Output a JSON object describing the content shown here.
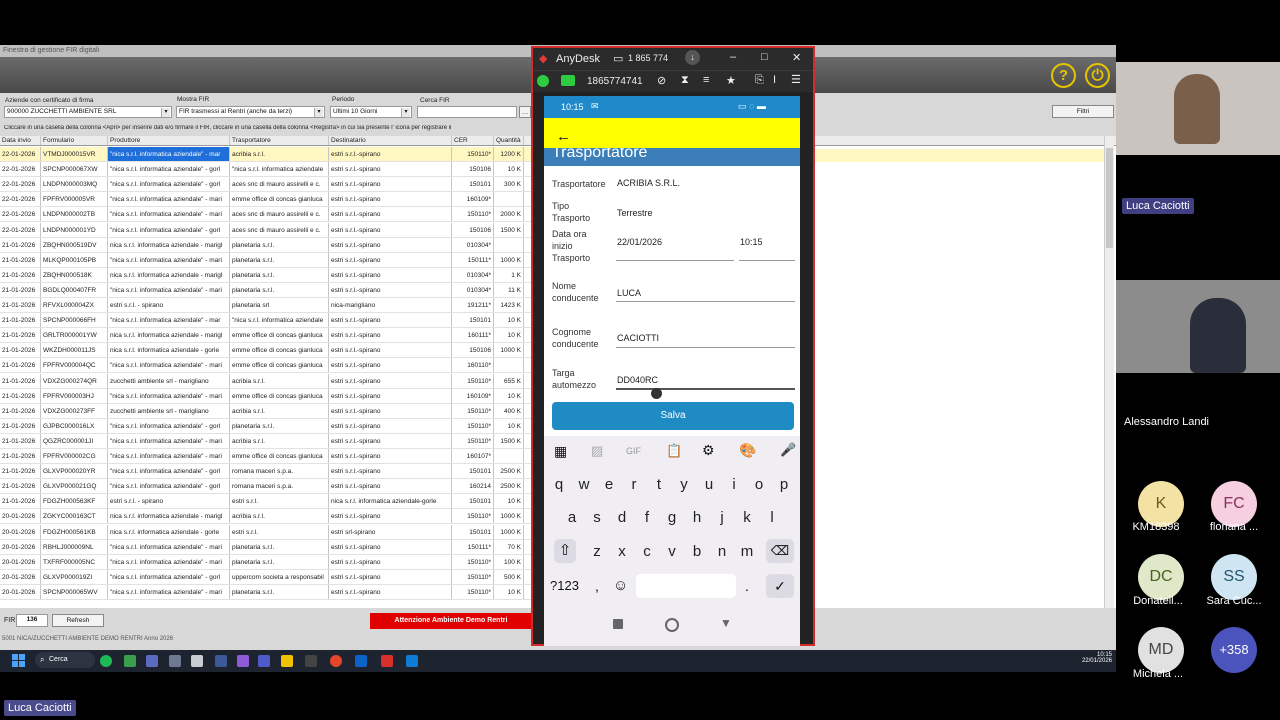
{
  "app": {
    "window_title": "Finestra di gestione FIR digitali",
    "filters": {
      "azienda_label": "Aziende con certificato di firma",
      "azienda_value": "900000 ZUCCHETTI AMBIENTE SRL",
      "mostra_label": "Mostra FIR",
      "mostra_value": "FIR trasmessi al Rentri (anche da terzi)",
      "periodo_label": "Periodo",
      "periodo_value": "Ultimi 10 Giorni",
      "cerca_label": "Cerca FIR",
      "cerca_value": "",
      "filtri_label": "Filtri"
    },
    "info_text": "Cliccare in una casella della colonna <Apri> per inserire dati e/o firmare il FIR, cliccare in una casella della colonna <Registra> in cui sia presente l' icona per registrare il",
    "columns": [
      "Data invio",
      "Formulario",
      "Produttore",
      "Trasportatore",
      "Destinatario",
      "CER",
      "Quantità"
    ],
    "rows": [
      [
        "22-01-2026",
        "VTMDJ000015VR",
        "\"nica s.r.l. informatica aziendale\" - mar",
        "acribia s.r.l.",
        "estri s.r.l.-spirano",
        "150110*",
        "1200 K"
      ],
      [
        "22-01-2026",
        "SPCNP000067XW",
        "\"nica s.r.l. informatica aziendale\" - gorl",
        "\"nica s.r.l. informatica aziendale",
        "estri s.r.l.-spirano",
        "150106",
        "10 K"
      ],
      [
        "22-01-2026",
        "LNDPN000003MQ",
        "\"nica s.r.l. informatica aziendale\" - gorl",
        "aces snc di mauro assirelli e c.",
        "estri s.r.l.-spirano",
        "150101",
        "300 K"
      ],
      [
        "22-01-2026",
        "FPFRV000005VR",
        "\"nica s.r.l. informatica aziendale\" - mari",
        "emme office di concas gianluca",
        "estri s.r.l.-spirano",
        "160109*",
        ""
      ],
      [
        "22-01-2026",
        "LNDPN000002TB",
        "\"nica s.r.l. informatica aziendale\" - mari",
        "aces snc di mauro assirelli e c.",
        "estri s.r.l.-spirano",
        "150110*",
        "2000 K"
      ],
      [
        "22-01-2026",
        "LNDPN000001YD",
        "\"nica s.r.l. informatica aziendale\" - gorl",
        "aces snc di mauro assirelli e c.",
        "estri s.r.l.-spirano",
        "150106",
        "1500 K"
      ],
      [
        "21-01-2026",
        "ZBQHN000519DV",
        "nica s.r.l. informatica aziendale - marigl",
        "planetaria s.r.l.",
        "estri s.r.l.-spirano",
        "010304*",
        ""
      ],
      [
        "21-01-2026",
        "MLKQP000105PB",
        "\"nica s.r.l. informatica aziendale\" - mari",
        "planetaria s.r.l.",
        "estri s.r.l.-spirano",
        "150111*",
        "1000 K"
      ],
      [
        "21-01-2026",
        "ZBQHN000518K",
        "nica s.r.l. informatica aziendale - marigl",
        "planetaria s.r.l.",
        "estri s.r.l.-spirano",
        "010304*",
        "1 K"
      ],
      [
        "21-01-2026",
        "BGDLQ000407FR",
        "\"nica s.r.l. informatica aziendale\" - mari",
        "planetaria s.r.l.",
        "estri s.r.l.-spirano",
        "010304*",
        "11 K"
      ],
      [
        "21-01-2026",
        "RFVXL000004ZX",
        "estri s.r.l. - spirano",
        "planetaria srl",
        "nica-marigliano",
        "191211*",
        "1423 K"
      ],
      [
        "21-01-2026",
        "SPCNP000066FH",
        "\"nica s.r.l. informatica aziendale\" - mar",
        "\"nica s.r.l. informatica aziendale",
        "estri s.r.l.-spirano",
        "150101",
        "10 K"
      ],
      [
        "21-01-2026",
        "GRLTR000001YW",
        "nica s.r.l. informatica aziendale - marigl",
        "emme office di concas gianluca",
        "estri s.r.l.-spirano",
        "160111*",
        "10 K"
      ],
      [
        "21-01-2026",
        "WKZDH000011JS",
        "nica s.r.l. informatica aziendale - gorle",
        "emme office di concas gianluca",
        "estri s.r.l.-spirano",
        "150106",
        "1000 K"
      ],
      [
        "21-01-2026",
        "FPFRV000004QC",
        "\"nica s.r.l. informatica aziendale\" - mari",
        "emme office di concas gianluca",
        "estri s.r.l.-spirano",
        "160110*",
        ""
      ],
      [
        "21-01-2026",
        "VDXZG000274QR",
        "zucchetti ambiente srl - marigliano",
        "acribia s.r.l.",
        "estri s.r.l.-spirano",
        "150110*",
        "655 K"
      ],
      [
        "21-01-2026",
        "FPFRV000003HJ",
        "\"nica s.r.l. informatica aziendale\" - mari",
        "emme office di concas gianluca",
        "estri s.r.l.-spirano",
        "160109*",
        "10 K"
      ],
      [
        "21-01-2026",
        "VDXZG000273FF",
        "zucchetti ambiente srl - marigliano",
        "acribia s.r.l.",
        "estri s.r.l.-spirano",
        "150110*",
        "400 K"
      ],
      [
        "21-01-2026",
        "GJPBC000016LX",
        "\"nica s.r.l. informatica aziendale\" - gorl",
        "planetaria s.r.l.",
        "estri s.r.l.-spirano",
        "150110*",
        "10 K"
      ],
      [
        "21-01-2026",
        "QGZRC000001JI",
        "\"nica s.r.l. informatica aziendale\" - mari",
        "acribia s.r.l.",
        "estri s.r.l.-spirano",
        "150110*",
        "1500 K"
      ],
      [
        "21-01-2026",
        "FPFRV000002CG",
        "\"nica s.r.l. informatica aziendale\" - mari",
        "emme office di concas gianluca",
        "estri s.r.l.-spirano",
        "160107*",
        ""
      ],
      [
        "21-01-2026",
        "GLXVP000020YR",
        "\"nica s.r.l. informatica aziendale\" - gorl",
        "romana maceri s.p.a.",
        "estri s.r.l.-spirano",
        "150101",
        "2500 K"
      ],
      [
        "21-01-2026",
        "GLXVP000021GQ",
        "\"nica s.r.l. informatica aziendale\" - gorl",
        "romana maceri s.p.a.",
        "estri s.r.l.-spirano",
        "160214",
        "2500 K"
      ],
      [
        "21-01-2026",
        "FDGZH000563KF",
        "estri s.r.l. - spirano",
        "estri s.r.l.",
        "nica s.r.l. informatica aziendale-gorle",
        "150101",
        "10 K"
      ],
      [
        "20-01-2026",
        "ZGKYC000163CT",
        "nica s.r.l. informatica aziendale - marigl",
        "acribia s.r.l.",
        "estri s.r.l.-spirano",
        "150110*",
        "1000 K"
      ],
      [
        "20-01-2026",
        "FDGZH000561KB",
        "nica s.r.l. informatica aziendale - gorle",
        "estri s.r.l.",
        "estri srl-spirano",
        "150101",
        "1000 K"
      ],
      [
        "20-01-2026",
        "RBHLJ000009NL",
        "\"nica s.r.l. informatica aziendale\" - mari",
        "planetaria s.r.l.",
        "estri s.r.l.-spirano",
        "150111*",
        "70 K"
      ],
      [
        "20-01-2026",
        "TXFRF000005NC",
        "\"nica s.r.l. informatica aziendale\" - mari",
        "planetaria s.r.l.",
        "estri s.r.l.-spirano",
        "150110*",
        "100 K"
      ],
      [
        "20-01-2026",
        "GLXVP000019ZI",
        "\"nica s.r.l. informatica aziendale\" - gorl",
        "uppercom societa a responsabil",
        "estri s.r.l.-spirano",
        "150110*",
        "500 K"
      ],
      [
        "20-01-2026",
        "SPCNP000065WV",
        "\"nica s.r.l. informatica aziendale\" - mari",
        "planetaria s.r.l.",
        "estri s.r.l.-spirano",
        "150110*",
        "10 K"
      ]
    ],
    "footer": {
      "fir_label": "FIR",
      "fir_count": "136",
      "refresh_label": "Refresh",
      "alert_text": "Attenzione Ambiente Demo Rentri",
      "status_text": "5001 NICA/ZUCCHETTI AMBIENTE DEMO RENTRI   Anno 2026"
    }
  },
  "taskbar": {
    "search_label": "Cerca",
    "time": "10:15",
    "date": "22/01/2026"
  },
  "anydesk": {
    "title": "AnyDesk",
    "session_label": "1 865 774",
    "address": "1865774741"
  },
  "phone": {
    "status_time": "10:15",
    "section_title": "Trasportatore",
    "fields": {
      "trasportatore_label": "Trasportatore",
      "trasportatore_value": "ACRIBIA S.R.L.",
      "tipo_label": "Tipo Trasporto",
      "tipo_value": "Terrestre",
      "data_label": "Data ora inizio Trasporto",
      "data_value": "22/01/2026",
      "ora_value": "10:15",
      "nome_label": "Nome conducente",
      "nome_value": "LUCA",
      "cognome_label": "Cognome conducente",
      "cognome_value": "CACIOTTI",
      "targa_label": "Targa automezzo",
      "targa_value": "DD040RC"
    },
    "save_label": "Salva",
    "keyboard": {
      "row1": [
        "q",
        "w",
        "e",
        "r",
        "t",
        "y",
        "u",
        "i",
        "o",
        "p"
      ],
      "row1_hints": [
        "1",
        "2",
        "3",
        "4",
        "5",
        "6",
        "7",
        "8",
        "9",
        "0"
      ],
      "row2": [
        "a",
        "s",
        "d",
        "f",
        "g",
        "h",
        "j",
        "k",
        "l"
      ],
      "row3": [
        "z",
        "x",
        "c",
        "v",
        "b",
        "n",
        "m"
      ],
      "sym_label": "?123",
      "comma": ",",
      "period": ".",
      "gif_label": "GIF"
    }
  },
  "meeting": {
    "participants": [
      {
        "name": "Luca Caciotti"
      },
      {
        "name": "Alessandro Landi"
      },
      {
        "initials": "K",
        "name": "KM18398",
        "color": "#f3e2a4"
      },
      {
        "initials": "FC",
        "name": "floriana ...",
        "color": "#f6cfe0"
      },
      {
        "initials": "DC",
        "name": "Donatell...",
        "color": "#dfe9c9"
      },
      {
        "initials": "SS",
        "name": "Sara Cuc...",
        "color": "#cfe6f2"
      },
      {
        "initials": "MD",
        "name": "Michela ...",
        "color": "#e1e1e1"
      },
      {
        "initials": "+358",
        "name": "",
        "color": "#4b53bc"
      }
    ],
    "presenter_label": "Luca Caciotti"
  }
}
